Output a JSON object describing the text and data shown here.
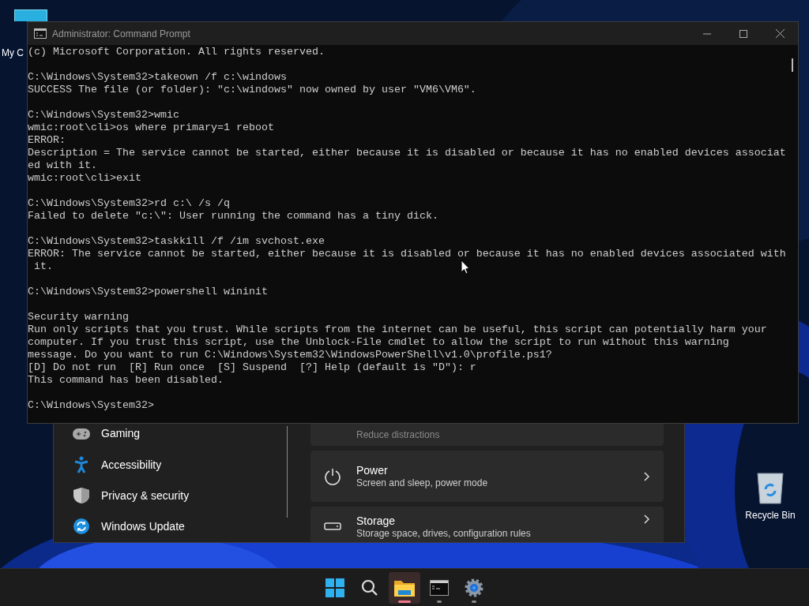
{
  "desktop_icons": [
    {
      "kind": "computer",
      "label": "My C"
    },
    {
      "kind": "recycle",
      "label": "Recycle Bin"
    }
  ],
  "settings": {
    "nav_items": [
      {
        "kind": "gaming",
        "label": "Gaming"
      },
      {
        "kind": "accessibility",
        "label": "Accessibility"
      },
      {
        "kind": "privacy",
        "label": "Privacy & security"
      },
      {
        "kind": "update",
        "label": "Windows Update"
      }
    ],
    "cards": [
      {
        "kind": "focus",
        "subtitle": "Reduce distractions"
      },
      {
        "kind": "power",
        "title": "Power",
        "subtitle": "Screen and sleep, power mode"
      },
      {
        "kind": "storage",
        "title": "Storage",
        "subtitle": "Storage space, drives, configuration rules"
      }
    ]
  },
  "console": {
    "window_title": "Administrator: Command Prompt",
    "blocks": [
      [
        "(c) Microsoft Corporation. All rights reserved."
      ],
      [
        "C:\\Windows\\System32>takeown /f c:\\windows",
        "SUCCESS The file (or folder): \"c:\\windows\" now owned by user \"VM6\\VM6\"."
      ],
      [
        "C:\\Windows\\System32>wmic",
        "wmic:root\\cli>os where primary=1 reboot",
        "ERROR:",
        "Description = The service cannot be started, either because it is disabled or because it has no enabled devices associat",
        "ed with it.",
        "wmic:root\\cli>exit"
      ],
      [
        "C:\\Windows\\System32>rd c:\\ /s /q",
        "Failed to delete \"c:\\\": User running the command has a tiny dick."
      ],
      [
        "C:\\Windows\\System32>taskkill /f /im svchost.exe",
        "ERROR: The service cannot be started, either because it is disabled or because it has no enabled devices associated with",
        " it."
      ],
      [
        "C:\\Windows\\System32>powershell wininit"
      ],
      [
        "Security warning",
        "Run only scripts that you trust. While scripts from the internet can be useful, this script can potentially harm your",
        "computer. If you trust this script, use the Unblock-File cmdlet to allow the script to run without this warning",
        "message. Do you want to run C:\\Windows\\System32\\WindowsPowerShell\\v1.0\\profile.ps1?",
        "[D] Do not run  [R] Run once  [S] Suspend  [?] Help (default is \"D\"): r",
        "This command has been disabled."
      ],
      [
        "C:\\Windows\\System32>"
      ]
    ]
  },
  "taskbar": {
    "apps": [
      {
        "kind": "start",
        "active": false,
        "running": false
      },
      {
        "kind": "search",
        "active": false,
        "running": false
      },
      {
        "kind": "explorer",
        "active": true,
        "running": true
      },
      {
        "kind": "terminal",
        "active": false,
        "running": true
      },
      {
        "kind": "settings",
        "active": false,
        "running": true
      }
    ]
  }
}
